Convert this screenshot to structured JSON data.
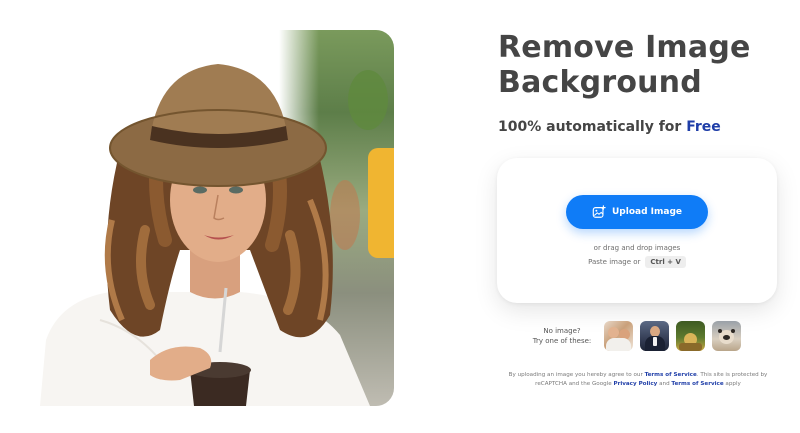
{
  "heading": {
    "title": "Remove Image Background",
    "subtitle_prefix": "100% automatically for ",
    "subtitle_highlight": "Free"
  },
  "upload": {
    "button_label": "Upload Image",
    "drag_text": "or drag and drop images",
    "paste_text": "Paste image or",
    "shortcut": "Ctrl + V"
  },
  "samples": {
    "label_line1": "No image?",
    "label_line2": "Try one of these:"
  },
  "legal": {
    "prefix": "By uploading an image you hereby agree to our ",
    "terms_link": "Terms of Service",
    "middle": ". This site is protected by reCAPTCHA and the Google ",
    "privacy_link": "Privacy Policy",
    "and": " and ",
    "terms_link2": "Terms of Service",
    "suffix": " apply"
  },
  "colors": {
    "accent": "#0f7cf7",
    "highlight": "#1f3ea8",
    "text": "#454545"
  },
  "icons": {
    "upload": "image-upload-icon"
  }
}
